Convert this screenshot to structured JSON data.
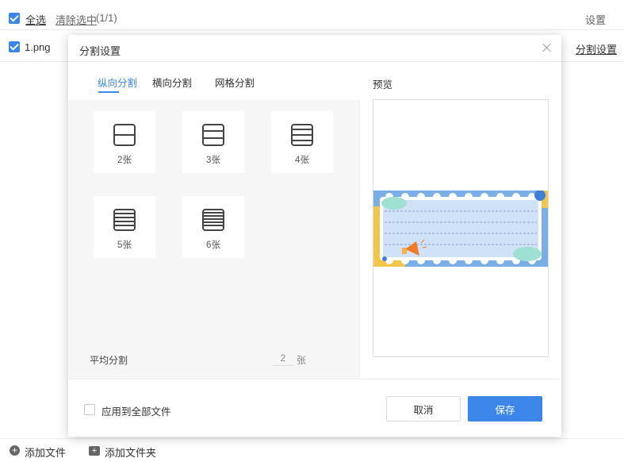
{
  "toolbar": {
    "select_all": "全选",
    "clear_selection": "清除选中",
    "selection_count": "(1/1)",
    "settings": "设置"
  },
  "file_row": {
    "filename": "1.png",
    "split_settings_link": "分割设置"
  },
  "bottom_bar": {
    "add_file": "添加文件",
    "add_folder": "添加文件夹"
  },
  "dialog": {
    "title": "分割设置",
    "tabs": [
      {
        "label": "纵向分割",
        "active": true
      },
      {
        "label": "横向分割",
        "active": false
      },
      {
        "label": "网格分割",
        "active": false
      }
    ],
    "options": [
      {
        "label": "2张",
        "parts": 2
      },
      {
        "label": "3张",
        "parts": 3
      },
      {
        "label": "4张",
        "parts": 4
      },
      {
        "label": "5张",
        "parts": 5
      },
      {
        "label": "6张",
        "parts": 6
      }
    ],
    "average_split_label": "平均分割",
    "average_split_value": "2",
    "average_split_unit": "张",
    "preview_title": "预览",
    "apply_all_label": "应用到全部文件",
    "cancel_label": "取消",
    "save_label": "保存"
  },
  "colors": {
    "accent": "#3b86e8",
    "panel_bg": "#f6f6f6"
  }
}
